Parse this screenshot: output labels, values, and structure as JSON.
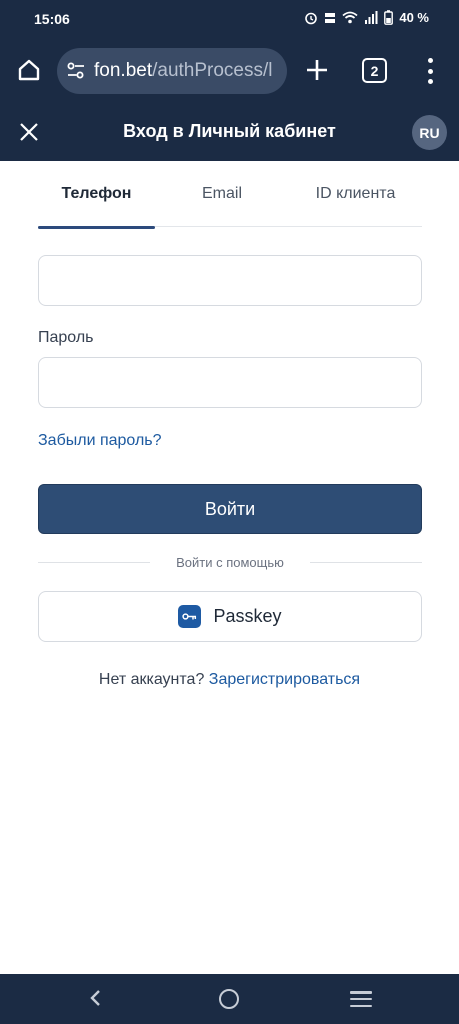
{
  "status_bar": {
    "time": "15:06",
    "battery": "40 %"
  },
  "browser": {
    "url_domain": "fon.bet",
    "url_path": "/authProcess/l",
    "tab_count": "2"
  },
  "header": {
    "title": "Вход в Личный кабинет",
    "language": "RU"
  },
  "tabs": [
    {
      "label": "Телефон",
      "active": true
    },
    {
      "label": "Email",
      "active": false
    },
    {
      "label": "ID клиента",
      "active": false
    }
  ],
  "form": {
    "phone_value": "",
    "password_label": "Пароль",
    "password_value": "",
    "forgot_link": "Забыли пароль?",
    "login_button": "Войти",
    "divider_text": "Войти с помощью",
    "passkey_button": "Passkey"
  },
  "register": {
    "prompt": "Нет аккаунта?",
    "link": "Зарегистрироваться"
  },
  "colors": {
    "header_bg": "#1b2b44",
    "primary": "#2e4d75",
    "link": "#1d5aa0"
  }
}
